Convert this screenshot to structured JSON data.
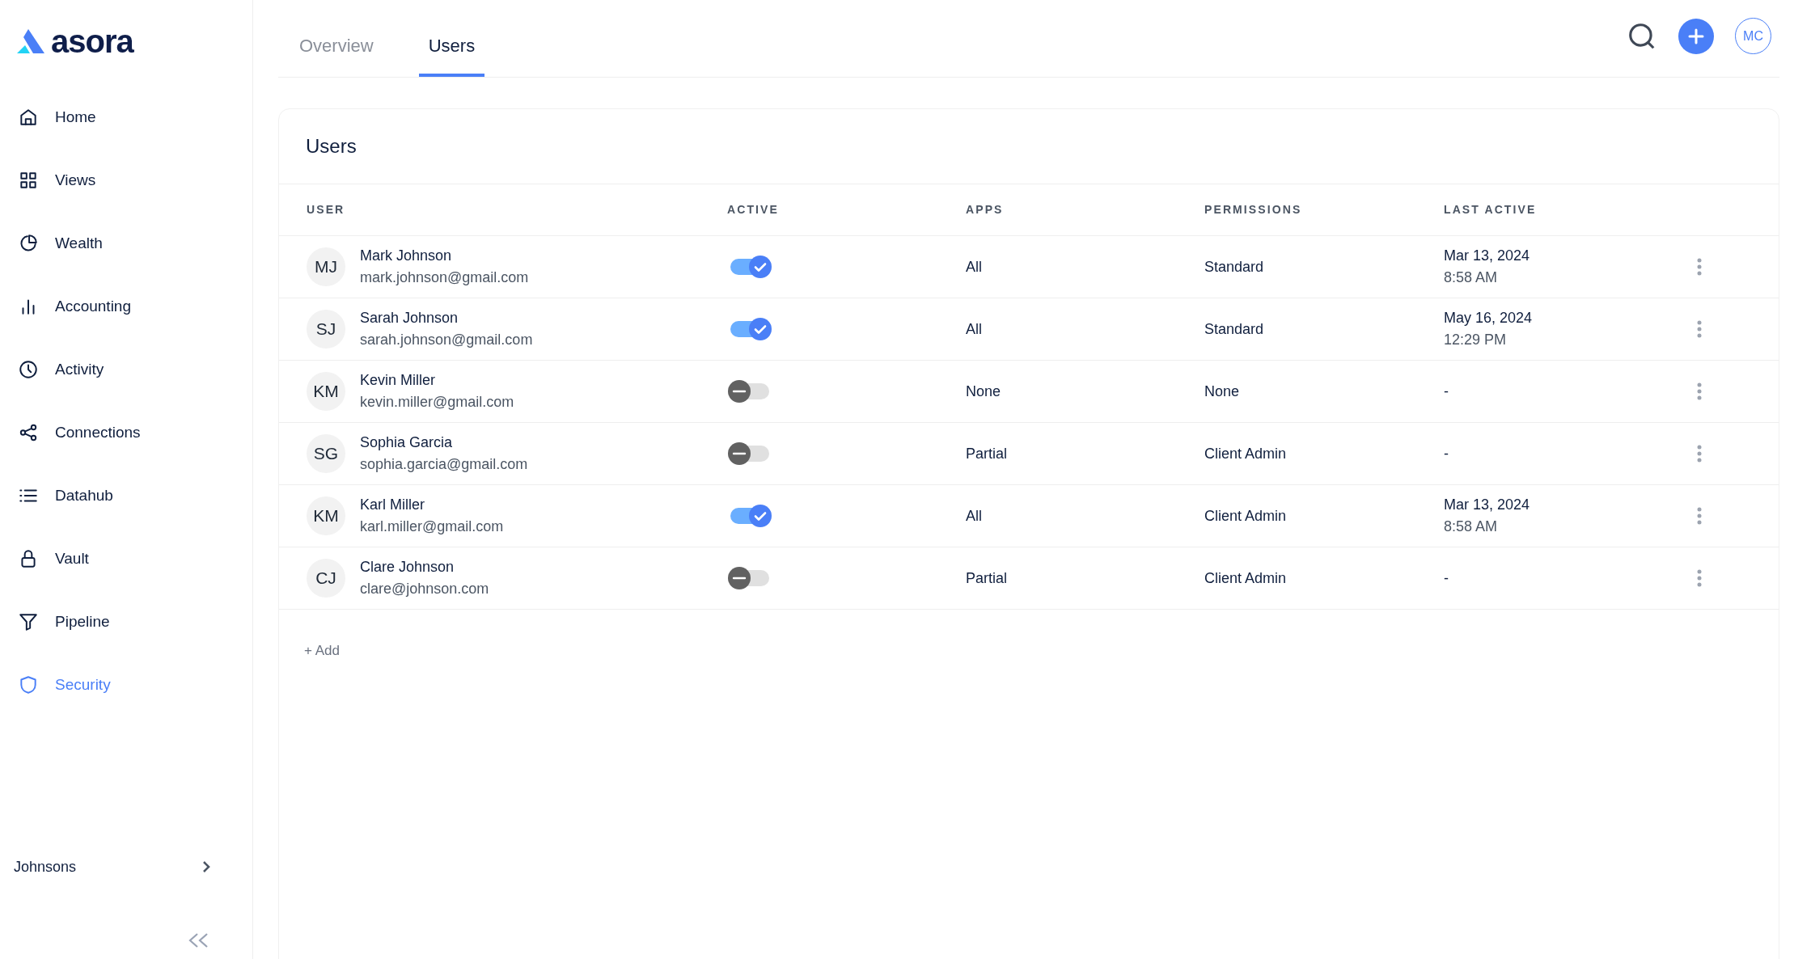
{
  "brand": {
    "name": "asora"
  },
  "sidebar": {
    "items": [
      {
        "label": "Home",
        "selected": false
      },
      {
        "label": "Views",
        "selected": false
      },
      {
        "label": "Wealth",
        "selected": false
      },
      {
        "label": "Accounting",
        "selected": false
      },
      {
        "label": "Activity",
        "selected": false
      },
      {
        "label": "Connections",
        "selected": false
      },
      {
        "label": "Datahub",
        "selected": false
      },
      {
        "label": "Vault",
        "selected": false
      },
      {
        "label": "Pipeline",
        "selected": false
      },
      {
        "label": "Security",
        "selected": true
      }
    ],
    "workspace": "Johnsons"
  },
  "tabs": [
    {
      "label": "Overview",
      "selected": false
    },
    {
      "label": "Users",
      "selected": true
    }
  ],
  "header": {
    "avatar": "MC"
  },
  "card": {
    "title": "Users",
    "table": {
      "columns": [
        "USER",
        "ACTIVE",
        "APPS",
        "PERMISSIONS",
        "LAST ACTIVE"
      ],
      "rows": [
        {
          "initials": "MJ",
          "name": "Mark Johnson",
          "email": "mark.johnson@gmail.com",
          "active": true,
          "apps": "All",
          "permissions": "Standard",
          "date": "Mar 13, 2024",
          "time": "8:58 AM"
        },
        {
          "initials": "SJ",
          "name": "Sarah Johnson",
          "email": "sarah.johnson@gmail.com",
          "active": true,
          "apps": "All",
          "permissions": "Standard",
          "date": "May 16, 2024",
          "time": "12:29 PM"
        },
        {
          "initials": "KM",
          "name": "Kevin Miller",
          "email": "kevin.miller@gmail.com",
          "active": false,
          "apps": "None",
          "permissions": "None",
          "date": "-"
        },
        {
          "initials": "SG",
          "name": "Sophia Garcia",
          "email": "sophia.garcia@gmail.com",
          "active": false,
          "apps": "Partial",
          "permissions": "Client Admin",
          "date": "-"
        },
        {
          "initials": "KM",
          "name": "Karl Miller",
          "email": "karl.miller@gmail.com",
          "active": true,
          "apps": "All",
          "permissions": "Client Admin",
          "date": "Mar 13, 2024",
          "time": "8:58 AM"
        },
        {
          "initials": "CJ",
          "name": "Clare Johnson",
          "email": "clare@johnson.com",
          "active": false,
          "apps": "Partial",
          "permissions": "Client Admin",
          "date": "-"
        }
      ]
    },
    "add_label": "+ Add"
  }
}
